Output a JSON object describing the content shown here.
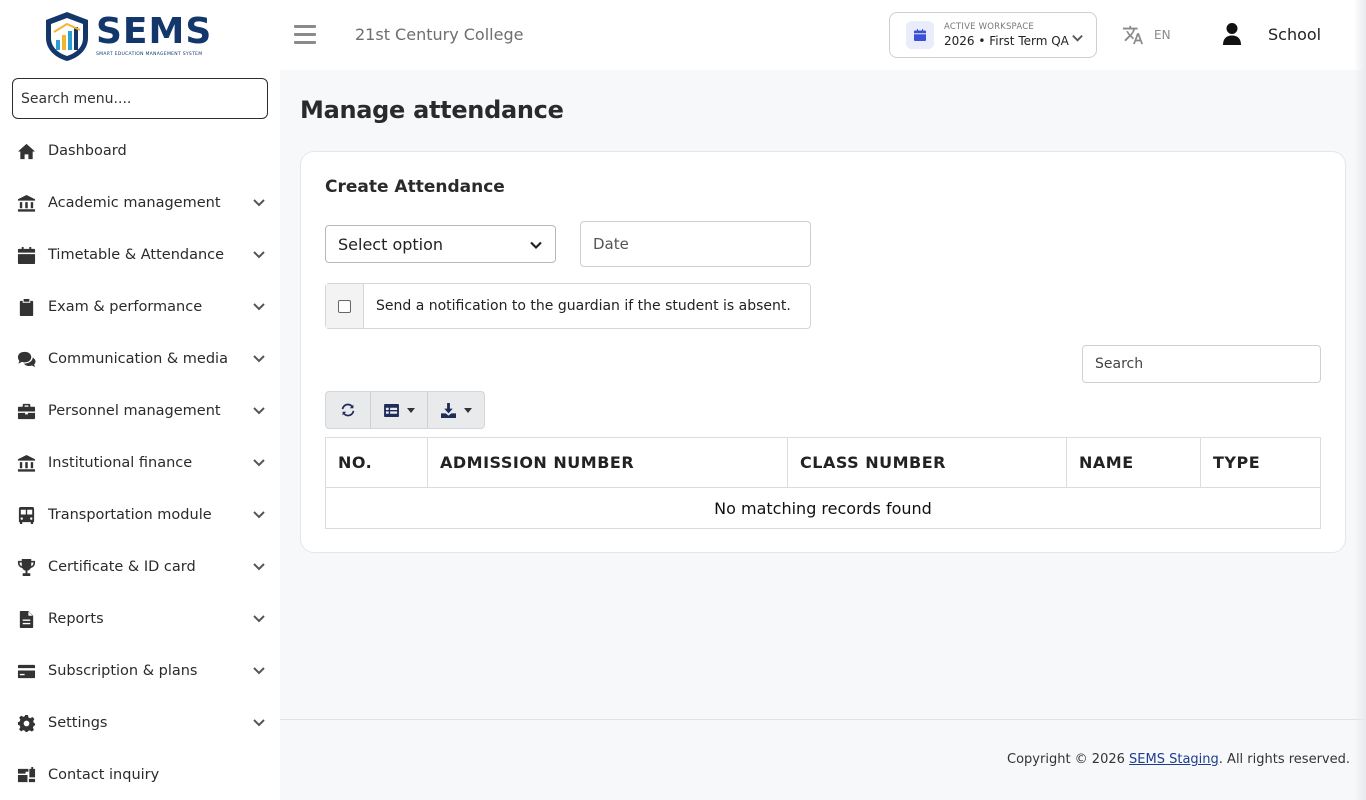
{
  "brand": {
    "logo_word": "SEMS",
    "logo_subtitle": "SMART EDUCATION MANAGEMENT SYSTEM"
  },
  "sidebar": {
    "search_placeholder": "Search menu....",
    "items": [
      {
        "label": "Dashboard",
        "icon": "home-icon",
        "expandable": false
      },
      {
        "label": "Academic management",
        "icon": "institution-icon",
        "expandable": true
      },
      {
        "label": "Timetable & Attendance",
        "icon": "calendar-icon",
        "expandable": true
      },
      {
        "label": "Exam & performance",
        "icon": "clipboard-icon",
        "expandable": true
      },
      {
        "label": "Communication & media",
        "icon": "comments-icon",
        "expandable": true
      },
      {
        "label": "Personnel management",
        "icon": "briefcase-icon",
        "expandable": true
      },
      {
        "label": "Institutional finance",
        "icon": "bank-icon",
        "expandable": true
      },
      {
        "label": "Transportation module",
        "icon": "bus-icon",
        "expandable": true
      },
      {
        "label": "Certificate & ID card",
        "icon": "trophy-icon",
        "expandable": true
      },
      {
        "label": "Reports",
        "icon": "file-icon",
        "expandable": true
      },
      {
        "label": "Subscription & plans",
        "icon": "credit-card-icon",
        "expandable": true
      },
      {
        "label": "Settings",
        "icon": "gear-icon",
        "expandable": true
      },
      {
        "label": "Contact inquiry",
        "icon": "mailbox-icon",
        "expandable": false
      }
    ]
  },
  "topbar": {
    "school_name": "21st Century College",
    "workspace_label": "ACTIVE WORKSPACE",
    "workspace_value": "2026 • First Term QA",
    "language_code": "EN",
    "user_name": "School"
  },
  "main": {
    "page_title": "Manage attendance",
    "card_title": "Create Attendance",
    "select_value": "Select option",
    "date_placeholder": "Date",
    "notify_label": "Send a notification to the guardian if the student is absent.",
    "table_search_placeholder": "Search",
    "columns": [
      "NO.",
      "ADMISSION NUMBER",
      "CLASS NUMBER",
      "NAME",
      "TYPE"
    ],
    "empty_message": "No matching records found"
  },
  "footer": {
    "prefix": "Copyright © 2026 ",
    "link": "SEMS Staging",
    "suffix": ". All rights reserved."
  },
  "colors": {
    "brand_navy": "#13366b",
    "accent_blue": "#3b50d6",
    "page_bg": "#f7f8fa"
  }
}
